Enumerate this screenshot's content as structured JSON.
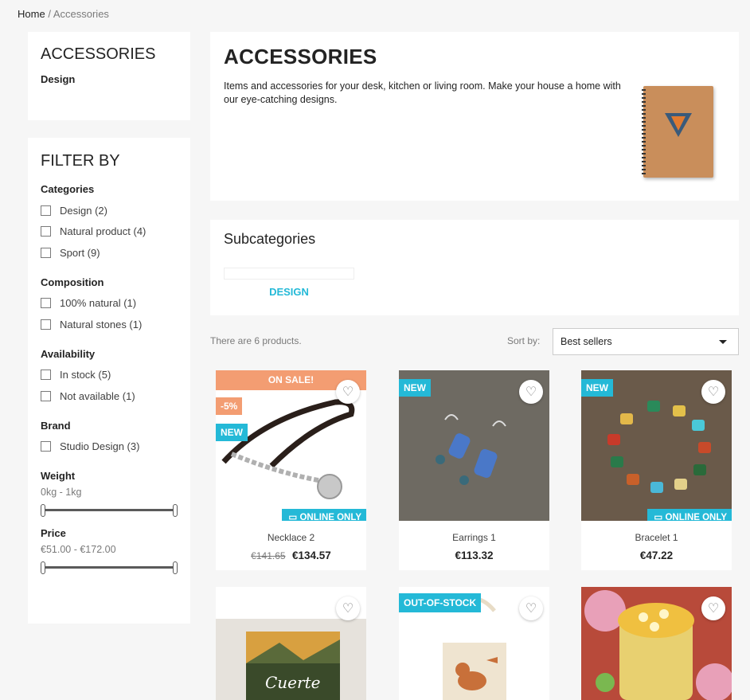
{
  "breadcrumb": {
    "home": "Home",
    "separator": "/",
    "current": "Accessories"
  },
  "category_box": {
    "title": "ACCESSORIES",
    "subcategory": "Design"
  },
  "filters": {
    "title": "FILTER BY",
    "categories": {
      "title": "Categories",
      "items": [
        "Design (2)",
        "Natural product (4)",
        "Sport (9)"
      ]
    },
    "composition": {
      "title": "Composition",
      "items": [
        "100% natural (1)",
        "Natural stones (1)"
      ]
    },
    "availability": {
      "title": "Availability",
      "items": [
        "In stock (5)",
        "Not available (1)"
      ]
    },
    "brand": {
      "title": "Brand",
      "items": [
        "Studio Design (3)"
      ]
    },
    "weight": {
      "title": "Weight",
      "range": "0kg - 1kg"
    },
    "price": {
      "title": "Price",
      "range": "€51.00 - €172.00"
    }
  },
  "header": {
    "title": "ACCESSORIES",
    "description": "Items and accessories for your desk, kitchen or living room. Make your house a home with our eye-catching designs."
  },
  "subcategories": {
    "title": "Subcategories",
    "items": [
      "DESIGN"
    ]
  },
  "listing": {
    "count_text": "There are 6 products.",
    "sort_label": "Sort by:",
    "sort_value": "Best sellers"
  },
  "products": [
    {
      "name": "Necklace 2",
      "old_price": "€141.65",
      "price": "€134.57",
      "on_sale": "ON SALE!",
      "discount": "-5%",
      "badge": "NEW",
      "online_only": "ONLINE ONLY"
    },
    {
      "name": "Earrings 1",
      "price": "€113.32",
      "badge": "NEW"
    },
    {
      "name": "Bracelet 1",
      "price": "€47.22",
      "badge": "NEW",
      "online_only": "ONLINE ONLY"
    },
    {
      "name": "",
      "price": "",
      "artwork_text": "Cuerte"
    },
    {
      "name": "",
      "price": "",
      "badge": "OUT-OF-STOCK"
    },
    {
      "name": "",
      "price": ""
    }
  ],
  "colors": {
    "accent": "#24b9d7",
    "sale": "#f39d72"
  }
}
